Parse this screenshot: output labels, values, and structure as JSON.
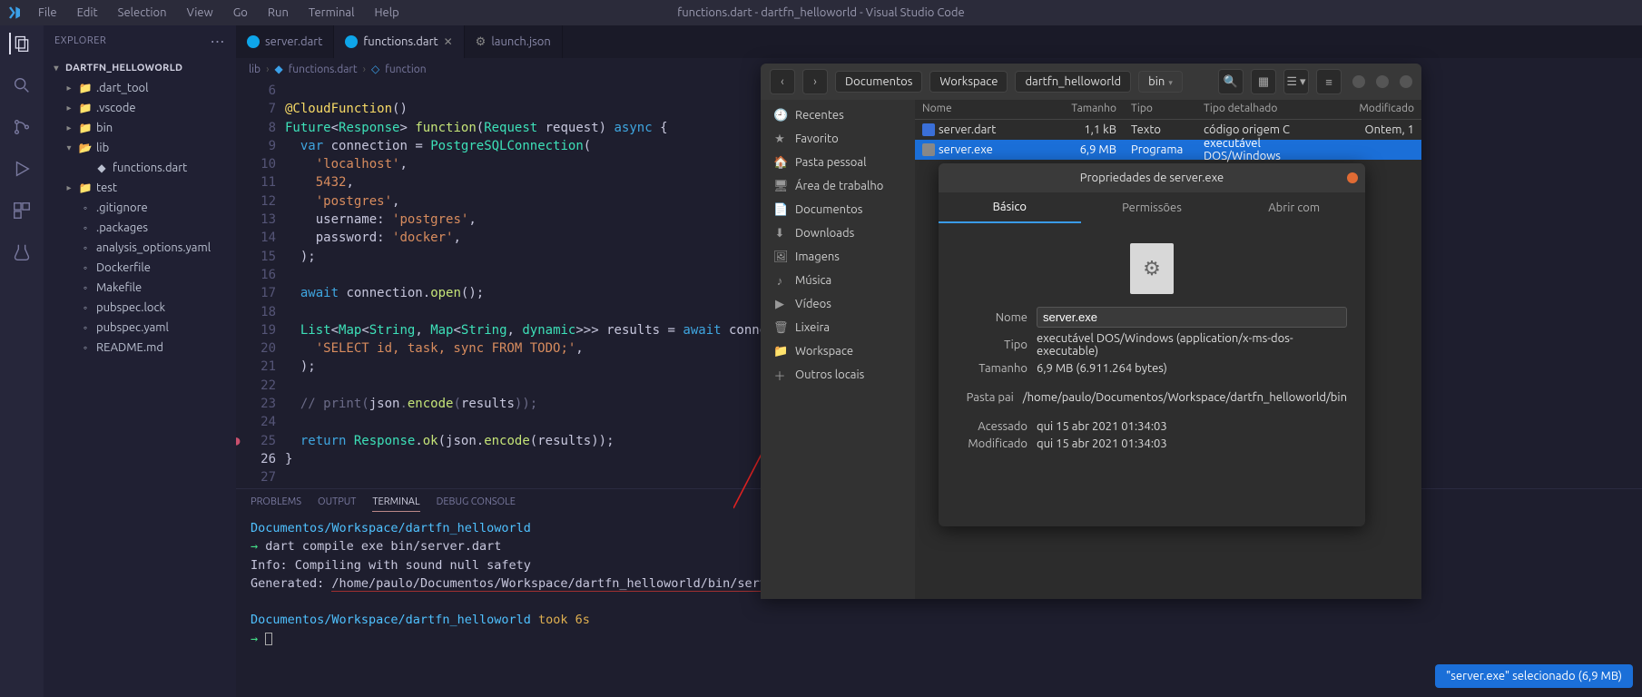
{
  "menubar": {
    "items": [
      "File",
      "Edit",
      "Selection",
      "View",
      "Go",
      "Run",
      "Terminal",
      "Help"
    ],
    "title": "functions.dart - dartfn_helloworld - Visual Studio Code"
  },
  "sidebar": {
    "title": "EXPLORER",
    "root": "DARTFN_HELLOWORLD",
    "tree": [
      {
        "name": ".dart_tool",
        "kind": "folder",
        "indent": 1,
        "expanded": false,
        "icon": "📁"
      },
      {
        "name": ".vscode",
        "kind": "folder",
        "indent": 1,
        "expanded": false,
        "icon": "📁"
      },
      {
        "name": "bin",
        "kind": "folder",
        "indent": 1,
        "expanded": false,
        "icon": "📁"
      },
      {
        "name": "lib",
        "kind": "folder",
        "indent": 1,
        "expanded": true,
        "icon": "📂"
      },
      {
        "name": "functions.dart",
        "kind": "file",
        "indent": 2,
        "icon": "◆"
      },
      {
        "name": "test",
        "kind": "folder",
        "indent": 1,
        "expanded": false,
        "icon": "📁"
      },
      {
        "name": ".gitignore",
        "kind": "file",
        "indent": 1,
        "icon": "◦"
      },
      {
        "name": ".packages",
        "kind": "file",
        "indent": 1,
        "icon": "◦"
      },
      {
        "name": "analysis_options.yaml",
        "kind": "file",
        "indent": 1,
        "icon": "◦"
      },
      {
        "name": "Dockerfile",
        "kind": "file",
        "indent": 1,
        "icon": "◦"
      },
      {
        "name": "Makefile",
        "kind": "file",
        "indent": 1,
        "icon": "◦"
      },
      {
        "name": "pubspec.lock",
        "kind": "file",
        "indent": 1,
        "icon": "◦"
      },
      {
        "name": "pubspec.yaml",
        "kind": "file",
        "indent": 1,
        "icon": "◦"
      },
      {
        "name": "README.md",
        "kind": "file",
        "indent": 1,
        "icon": "◦"
      }
    ]
  },
  "tabs": [
    {
      "label": "server.dart",
      "active": false,
      "icon": "dart"
    },
    {
      "label": "functions.dart",
      "active": true,
      "icon": "dart"
    },
    {
      "label": "launch.json",
      "active": false,
      "icon": "json"
    }
  ],
  "breadcrumb": [
    "lib",
    "functions.dart",
    "function"
  ],
  "code": {
    "start": 6,
    "lines": [
      "",
      "@CloudFunction()",
      "Future<Response> function(Request request) async {",
      "  var connection = PostgreSQLConnection(",
      "    'localhost',",
      "    5432,",
      "    'postgres',",
      "    username: 'postgres',",
      "    password: 'docker',",
      "  );",
      "",
      "  await connection.open();",
      "",
      "  List<Map<String, Map<String, dynamic>>> results = await connecti",
      "    'SELECT id, task, sync FROM TODO;',",
      "  );",
      "",
      "  // print(json.encode(results));",
      "",
      "  return Response.ok(json.encode(results));",
      "}",
      ""
    ],
    "breakpoint_line": 25,
    "current_line": 26
  },
  "panel": {
    "tabs": [
      "PROBLEMS",
      "OUTPUT",
      "TERMINAL",
      "DEBUG CONSOLE"
    ],
    "active": "TERMINAL",
    "terminal": {
      "cwd1": "Documentos/Workspace/dartfn_helloworld",
      "cmd": "dart compile exe bin/server.dart",
      "info": "Info: Compiling with sound null safety",
      "gen_label": "Generated: ",
      "gen_path": "/home/paulo/Documentos/Workspace/dartfn_helloworld/bin/server.exe",
      "cwd2": "Documentos/Workspace/dartfn_helloworld",
      "took": "took 6s"
    }
  },
  "fm": {
    "path": [
      "Documentos",
      "Workspace",
      "dartfn_helloworld",
      "bin"
    ],
    "sidebar": [
      {
        "icon": "🕘",
        "label": "Recentes"
      },
      {
        "icon": "★",
        "label": "Favorito"
      },
      {
        "icon": "🏠",
        "label": "Pasta pessoal"
      },
      {
        "icon": "🖥",
        "label": "Área de trabalho"
      },
      {
        "icon": "📄",
        "label": "Documentos"
      },
      {
        "icon": "⬇",
        "label": "Downloads"
      },
      {
        "icon": "🖼",
        "label": "Imagens"
      },
      {
        "icon": "♪",
        "label": "Música"
      },
      {
        "icon": "▶",
        "label": "Vídeos"
      },
      {
        "icon": "🗑",
        "label": "Lixeira"
      },
      {
        "icon": "📁",
        "label": "Workspace"
      },
      {
        "icon": "＋",
        "label": "Outros locais"
      }
    ],
    "columns": {
      "name": "Nome",
      "size": "Tamanho",
      "type": "Tipo",
      "detail": "Tipo detalhado",
      "mod": "Modificado"
    },
    "rows": [
      {
        "name": "server.dart",
        "size": "1,1 kB",
        "type": "Texto",
        "detail": "código origem C",
        "mod": "Ontem, 1",
        "sel": false,
        "icon": "c"
      },
      {
        "name": "server.exe",
        "size": "6,9 MB",
        "type": "Programa",
        "detail": "executável DOS/Windows",
        "mod": "",
        "sel": true,
        "icon": "exe"
      }
    ],
    "status": "\"server.exe\" selecionado (6,9 MB)"
  },
  "prop": {
    "title": "Propriedades de server.exe",
    "tabs": [
      "Básico",
      "Permissões",
      "Abrir com"
    ],
    "active": "Básico",
    "fields": {
      "name_label": "Nome",
      "name_value": "server.exe",
      "type_label": "Tipo",
      "type_value": "executável DOS/Windows (application/x-ms-dos-executable)",
      "size_label": "Tamanho",
      "size_value": "6,9 MB (6.911.264 bytes)",
      "parent_label": "Pasta pai",
      "parent_value": "/home/paulo/Documentos/Workspace/dartfn_helloworld/bin",
      "accessed_label": "Acessado",
      "accessed_value": "qui 15 abr 2021 01:34:03",
      "modified_label": "Modificado",
      "modified_value": "qui 15 abr 2021 01:34:03"
    }
  }
}
